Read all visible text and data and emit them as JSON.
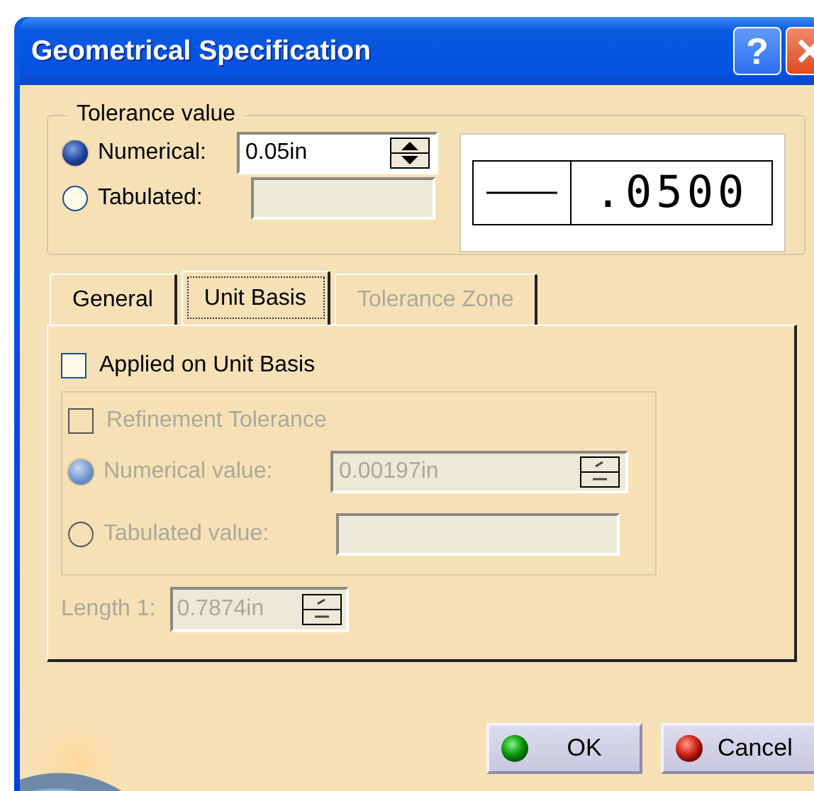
{
  "window": {
    "title": "Geometrical Specification",
    "help_button": "?"
  },
  "tolerance_value": {
    "legend": "Tolerance value",
    "options": [
      {
        "label": "Numerical:",
        "selected": true,
        "kind": "spin",
        "value": "0.05in"
      },
      {
        "label": "Tabulated:",
        "selected": false,
        "kind": "combo"
      }
    ],
    "preview": {
      "value": ".0500"
    }
  },
  "tabs": [
    {
      "label": "General",
      "selected": false,
      "disabled": false
    },
    {
      "label": "Unit Basis",
      "selected": true,
      "disabled": false
    },
    {
      "label": "Tolerance Zone",
      "selected": false,
      "disabled": true
    }
  ],
  "unit_basis": {
    "applied": {
      "label": "Applied on Unit Basis",
      "checked": false
    },
    "refinement": {
      "label": "Refinement Tolerance",
      "checked": false,
      "disabled": true,
      "options": [
        {
          "label": "Numerical value:",
          "selected": true,
          "kind": "spin",
          "value": "0.00197in"
        },
        {
          "label": "Tabulated value:",
          "selected": false,
          "kind": "combo"
        }
      ]
    },
    "length": {
      "label": "Length 1:",
      "value": "0.7874in",
      "disabled": true
    }
  },
  "buttons": [
    {
      "label": "OK",
      "kind": "ok"
    },
    {
      "label": "Cancel",
      "kind": "cancel"
    }
  ]
}
